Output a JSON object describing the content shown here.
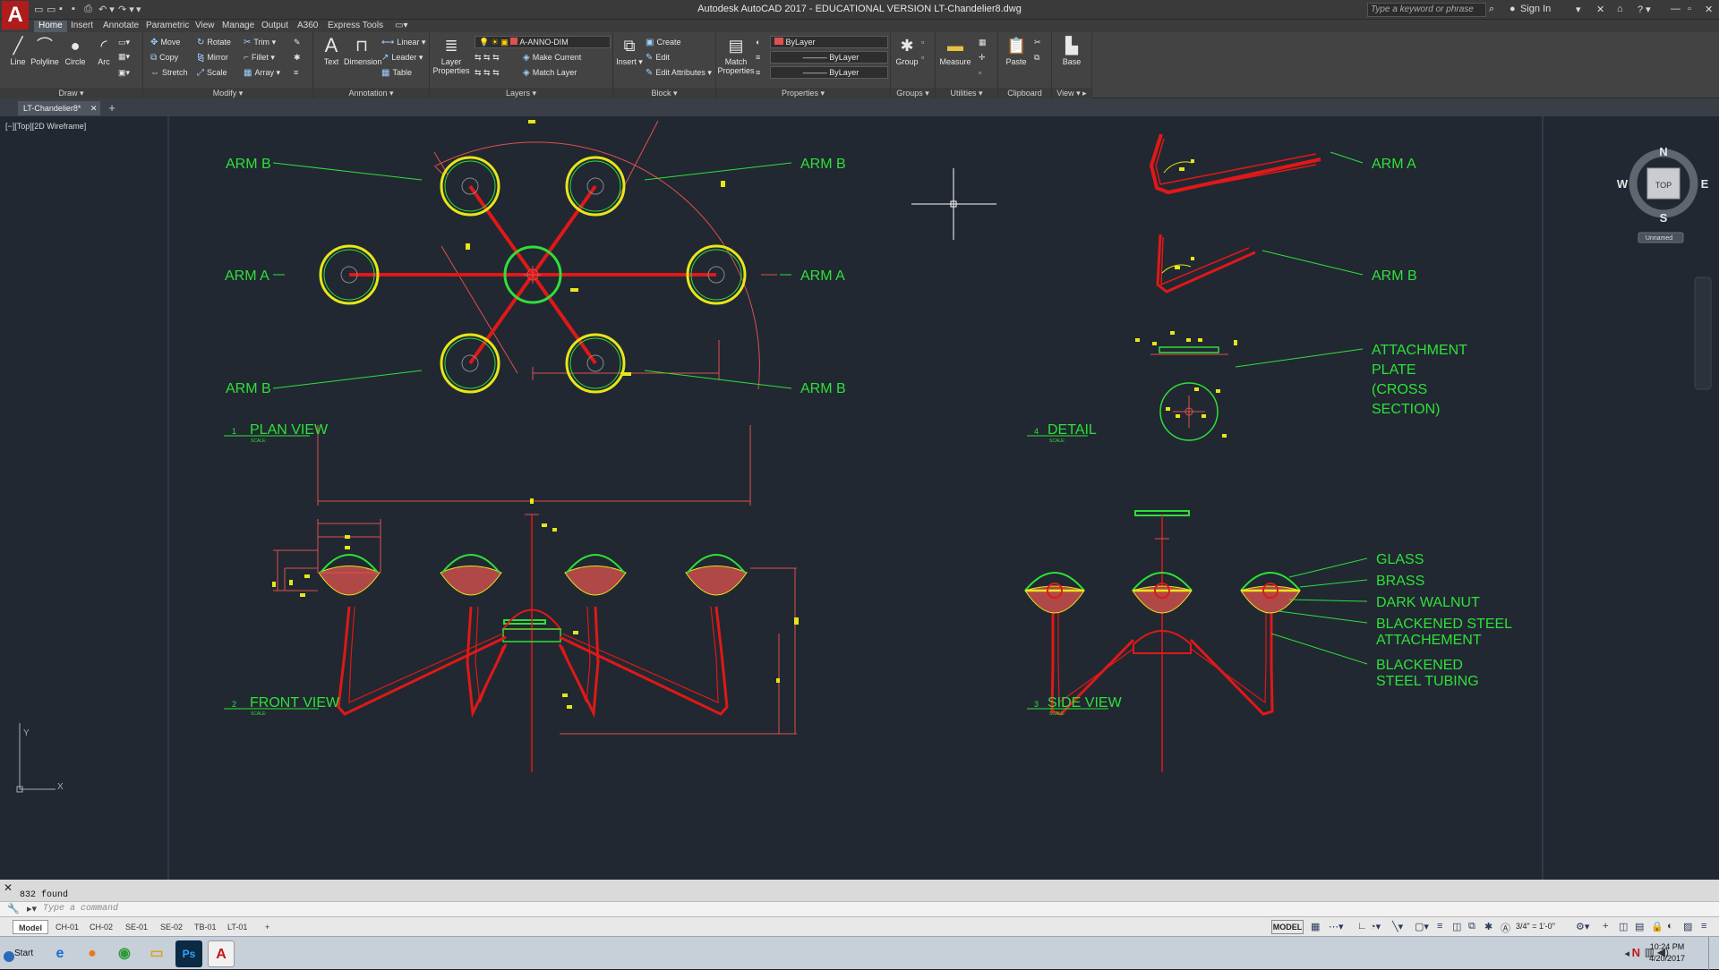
{
  "titlebar": {
    "app_icon": "A",
    "title": "Autodesk AutoCAD 2017 - EDUCATIONAL VERSION    LT-Chandelier8.dwg",
    "search_placeholder": "Type a keyword or phrase",
    "sign_in": "Sign In"
  },
  "ribbon_tabs": [
    "Home",
    "Insert",
    "Annotate",
    "Parametric",
    "View",
    "Manage",
    "Output",
    "A360",
    "Express Tools"
  ],
  "ribbon": {
    "draw": {
      "title": "Draw",
      "tools": [
        "Line",
        "Polyline",
        "Circle",
        "Arc"
      ]
    },
    "modify": {
      "title": "Modify",
      "tools": [
        "Move",
        "Rotate",
        "Trim",
        "Copy",
        "Mirror",
        "Fillet",
        "Stretch",
        "Scale",
        "Array"
      ]
    },
    "annotation": {
      "title": "Annotation",
      "tools": [
        "Text",
        "Dimension",
        "Linear",
        "Leader",
        "Table"
      ]
    },
    "layers": {
      "title": "Layers",
      "layer_properties": "Layer Properties",
      "current_layer": "A-ANNO-DIM",
      "make_current": "Make Current",
      "match_layer": "Match Layer"
    },
    "block": {
      "title": "Block",
      "insert": "Insert",
      "create": "Create",
      "edit": "Edit",
      "edit_attributes": "Edit Attributes"
    },
    "properties": {
      "title": "Properties",
      "match_properties": "Match Properties",
      "color": "ByLayer",
      "linetype": "ByLayer",
      "lineweight": "ByLayer",
      "color_swatch": "#e05050"
    },
    "groups": {
      "title": "Groups",
      "group": "Group"
    },
    "utilities": {
      "title": "Utilities",
      "measure": "Measure"
    },
    "clipboard": {
      "title": "Clipboard",
      "paste": "Paste"
    },
    "view": {
      "title": "View",
      "base": "Base"
    }
  },
  "doc_tab": {
    "name": "LT-Chandelier8*"
  },
  "viewport_label": "[−][Top][2D Wireframe]",
  "viewcube": {
    "top": "TOP",
    "north": "N",
    "south": "S",
    "east": "E",
    "west": "W",
    "ucs": "Unnamed"
  },
  "drawing": {
    "plan_view": {
      "num": "1",
      "title": "PLAN VIEW",
      "scale": "SCALE:"
    },
    "detail": {
      "num": "4",
      "title": "DETAIL",
      "scale": "SCALE:"
    },
    "front_view": {
      "num": "2",
      "title": "FRONT VIEW",
      "scale": "SCALE:"
    },
    "side_view": {
      "num": "3",
      "title": "SIDE VIEW",
      "scale": "SCALE:"
    },
    "labels": {
      "arm_b": "ARM B",
      "arm_a": "ARM A",
      "attachment_plate": [
        "ATTACHMENT",
        "PLATE",
        "(CROSS",
        "SECTION)"
      ],
      "glass": "GLASS",
      "brass": "BRASS",
      "dark_walnut": "DARK WALNUT",
      "blackened_steel_attachment": [
        "BLACKENED STEEL",
        "ATTACHEMENT"
      ],
      "blackened_steel_tubing": [
        "BLACKENED",
        "STEEL TUBING"
      ]
    },
    "colors": {
      "green": "#2ee03a",
      "red": "#e01818",
      "yellow": "#e6e61a",
      "dim": "#e05050",
      "bg": "#212831"
    }
  },
  "command": {
    "history": "832 found",
    "placeholder": "Type a command"
  },
  "layout_tabs": [
    "Model",
    "CH-01",
    "CH-02",
    "SE-01",
    "SE-02",
    "TB-01",
    "LT-01"
  ],
  "status": {
    "space": "MODEL",
    "scale": "3/4\" = 1'-0\""
  },
  "taskbar": {
    "start": "Start",
    "time": "10:24 PM",
    "date": "4/20/2017"
  }
}
